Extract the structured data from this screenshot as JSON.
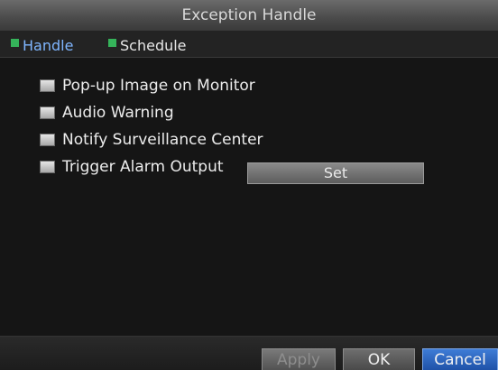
{
  "window": {
    "title": "Exception Handle"
  },
  "tabs": [
    {
      "label": "Handle",
      "active": true
    },
    {
      "label": "Schedule",
      "active": false
    }
  ],
  "options": [
    {
      "label": "Pop-up Image on Monitor",
      "checked": false
    },
    {
      "label": "Audio Warning",
      "checked": false
    },
    {
      "label": "Notify Surveillance Center",
      "checked": false
    },
    {
      "label": "Trigger Alarm Output",
      "checked": false
    }
  ],
  "set_button": {
    "label": "Set"
  },
  "footer": {
    "apply_label": "Apply",
    "ok_label": "OK",
    "cancel_label": "Cancel"
  },
  "colors": {
    "active_tab": "#7fb6ff",
    "tab_marker": "#35b35a",
    "cancel_button": "#2a62bd"
  }
}
